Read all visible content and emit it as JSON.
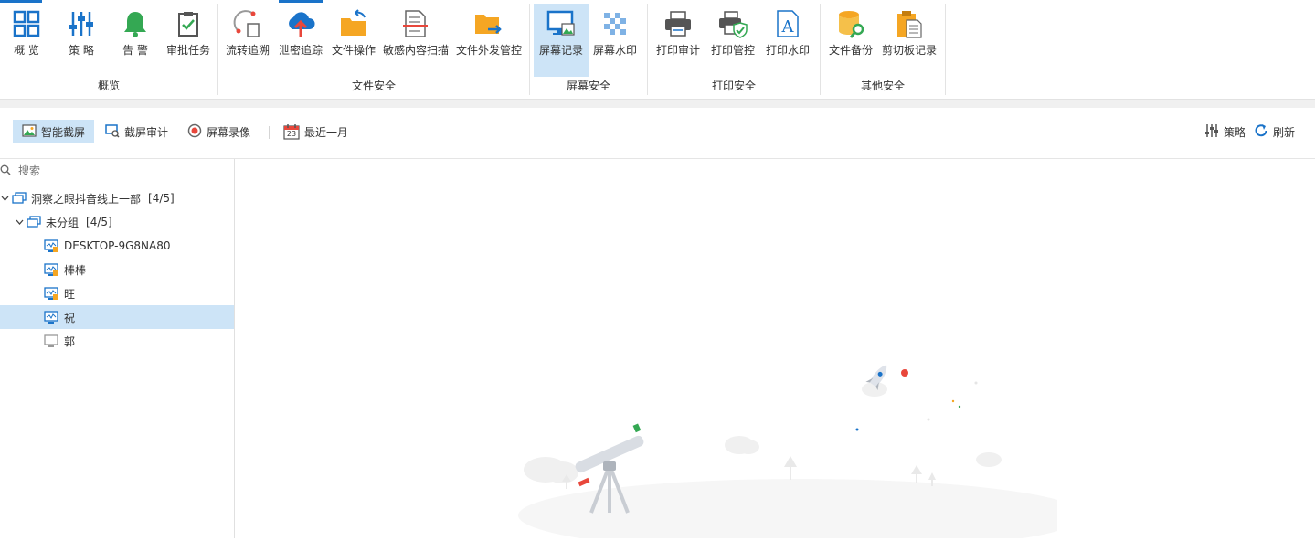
{
  "ribbon": {
    "groups": [
      {
        "label": "概览",
        "items": [
          {
            "label": "概 览",
            "icon": "grid-icon"
          },
          {
            "label": "策 略",
            "icon": "sliders-icon"
          },
          {
            "label": "告 警",
            "icon": "bell-icon"
          },
          {
            "label": "审批任务",
            "icon": "clipboard-check-icon"
          }
        ]
      },
      {
        "label": "文件安全",
        "items": [
          {
            "label": "流转追溯",
            "icon": "flow-trace-icon"
          },
          {
            "label": "泄密追踪",
            "icon": "cloud-upload-icon"
          },
          {
            "label": "文件操作",
            "icon": "folder-arrow-icon"
          },
          {
            "label": "敏感内容扫描",
            "icon": "document-scan-icon"
          },
          {
            "label": "文件外发管控",
            "icon": "folder-send-icon"
          }
        ]
      },
      {
        "label": "屏幕安全",
        "items": [
          {
            "label": "屏幕记录",
            "icon": "monitor-image-icon",
            "active": true
          },
          {
            "label": "屏幕水印",
            "icon": "checker-watermark-icon"
          }
        ]
      },
      {
        "label": "打印安全",
        "items": [
          {
            "label": "打印审计",
            "icon": "printer-icon"
          },
          {
            "label": "打印管控",
            "icon": "printer-shield-icon"
          },
          {
            "label": "打印水印",
            "icon": "letter-a-icon"
          }
        ]
      },
      {
        "label": "其他安全",
        "items": [
          {
            "label": "文件备份",
            "icon": "database-search-icon"
          },
          {
            "label": "剪切板记录",
            "icon": "clipboard-icon"
          }
        ]
      }
    ]
  },
  "toolbar": {
    "smart_screenshot": "智能截屏",
    "screenshot_audit": "截屏审计",
    "screen_recording": "屏幕录像",
    "date_range": "最近一月",
    "calendar_day": "23",
    "policy": "策略",
    "refresh": "刷新"
  },
  "sidebar": {
    "search_placeholder": "搜索",
    "root": {
      "label": "洞察之眼抖音线上一部",
      "count": "[4/5]"
    },
    "group": {
      "label": "未分组",
      "count": "[4/5]"
    },
    "devices": [
      {
        "label": "DESKTOP-9G8NA80",
        "status": "online-locked"
      },
      {
        "label": "棒棒",
        "status": "online-locked"
      },
      {
        "label": "旺",
        "status": "online-locked"
      },
      {
        "label": "祝",
        "status": "online",
        "selected": true
      },
      {
        "label": "郭",
        "status": "offline"
      }
    ]
  },
  "colors": {
    "accent": "#1a73c9",
    "selected_bg": "#cde4f7",
    "icon_orange": "#f5a623",
    "icon_red": "#e8473b",
    "icon_green": "#34a853"
  }
}
